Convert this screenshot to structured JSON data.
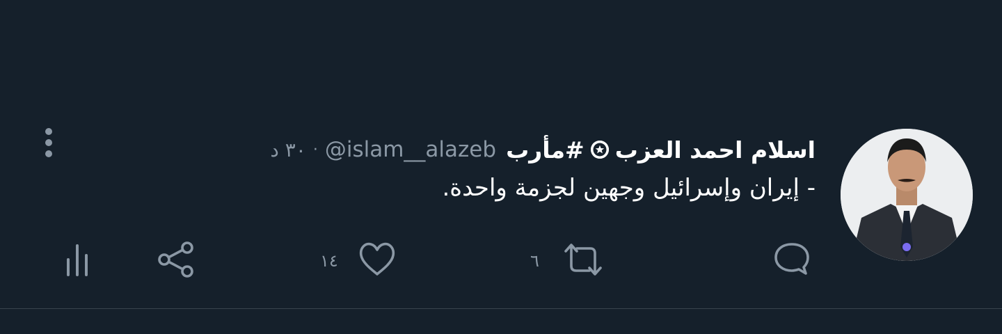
{
  "tweet": {
    "display_name": "اسلام احمد العزب",
    "hashtag": "#مأرب",
    "handle": "@islam__alazeb",
    "separator": "·",
    "time": "٣٠ د",
    "text": "- إيران وإسرائيل وجهين لجزمة واحدة."
  },
  "actions": {
    "reply_icon": "speech-bubble-icon",
    "retweet_icon": "retweet-arrows-icon",
    "retweet_count": "٦",
    "like_icon": "heart-outline-icon",
    "like_count": "١٤",
    "share_icon": "share-nodes-icon",
    "analytics_icon": "bar-chart-icon",
    "more_icon": "vertical-ellipsis-icon"
  },
  "colors": {
    "background": "#15202b",
    "primary_text": "#ffffff",
    "secondary_text": "#8b98a5",
    "divider": "#38444d"
  }
}
